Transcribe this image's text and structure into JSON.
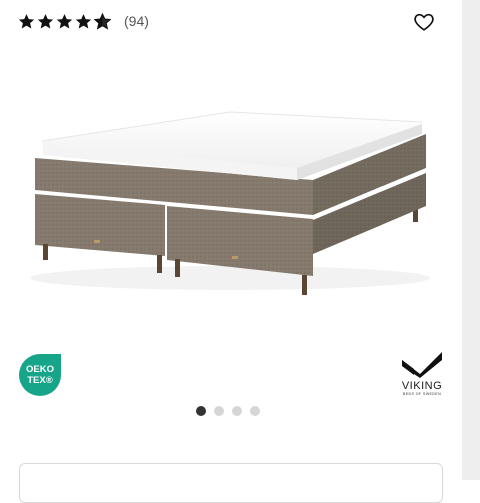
{
  "rating": {
    "stars_filled": 4.5,
    "stars_total": 5,
    "count_text": "(94)"
  },
  "badges": {
    "oeko_line1": "OEKO",
    "oeko_line2": "TEX®",
    "brand_name": "VIKING",
    "brand_tagline": "BEDS OF SWEDEN"
  },
  "carousel": {
    "slide_count": 4,
    "active_index": 0
  },
  "colors": {
    "oeko_green": "#16a589",
    "fabric": "#857a6d",
    "dot_active": "#333333",
    "dot_inactive": "#d6d6d6"
  },
  "icons": {
    "wishlist": "heart-outline-icon",
    "rating": "star-icon"
  }
}
